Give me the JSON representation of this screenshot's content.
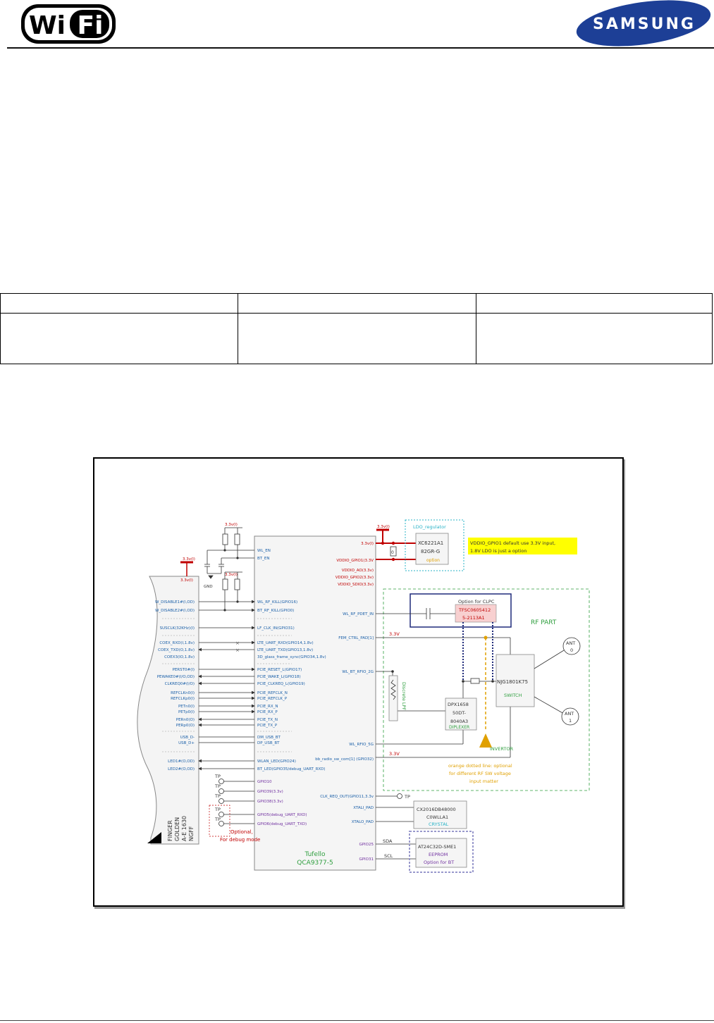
{
  "header": {
    "wifi_logo_text": "Wi Fi",
    "brand_logo_text": "SAMSUNG"
  },
  "table": {
    "rows": [
      [
        "",
        "",
        ""
      ],
      [
        "",
        "",
        ""
      ]
    ]
  },
  "colors": {
    "pin_blue": "#1a5fa8",
    "rail_red": "#c00000",
    "green": "#2e9e3e",
    "purple": "#7030a0",
    "teal": "#2ab3c7",
    "orange": "#e0a000",
    "navy": "#1f2a7a",
    "note_yellow": "#ffff00"
  },
  "schematic": {
    "left_pins": [
      "W_DISABLE1#(I,OD)",
      "W_DISABLE2#(I,OD)",
      "SUSCLK(32KHz)(I)",
      "COEX_RXD(I,1.8v)",
      "COEX_TXD(O,1.8v)",
      "COEX3(IO,1.8v)",
      "PERST0#(I)",
      "PEWAKE0#(I/O,OD)",
      "CLKREQ0#(I/O)",
      "REFCLKn0(I)",
      "REFCLKp0(I)",
      "PETn0(I)",
      "PETp0(I)",
      "PERn0(O)",
      "PERp0(O)",
      "USB_D-",
      "USB_D+",
      "LED1#(O,OD)",
      "LED2#(O,OD)"
    ],
    "chip_left_pins": [
      "WL_EN",
      "BT_EN",
      "WL_RF_KILL(GPIO16)",
      "BT_RF_KILL(GPIO0)",
      "LF_CLK_IN(GPIO31)",
      "LTE_UART_RXD(GPIO14,1.8v)",
      "LTE_UART_TXD(GPIO13,1.8v)",
      "3D_glass_frame_sync(GPIO34,1.8v)",
      "PCIE_RESET_L(GPIO17)",
      "PCIE_WAKE_L(GPIO18)",
      "PCIE_CLKREQ_L(GPIO19)",
      "PCIE_REFCLK_N",
      "PCIE_REFCLK_P",
      "PCIE_RX_N",
      "PCIE_RX_P",
      "PCIE_TX_N",
      "PCIE_TX_P",
      "DM_USB_BT",
      "DP_USB_BT",
      "WLAN_LED(GPIO24)",
      "BT_LED(GPIO35/debug_UART_RXD)",
      "GPIO10",
      "GPIO39(3.3v)",
      "GPIO38(3.3v)",
      "GPIO5(debug_UART_RXD)",
      "GPIO6(debug_UART_TXD)"
    ],
    "chip_right_pins": [
      "3.3v(I)",
      "VDDIO_GPIO1(3.3V",
      "VDDIO_AO(3.3v)",
      "VDDIO_GPIO2(3.3v)",
      "VDDIO_SDIO(3.3v)",
      "WL_RF_PDET_IN",
      "FEM_CTRL_PAD[1]",
      "WL_BT_RFIO_2G",
      "WL_RFIO_5G",
      "bb_radio_sw_com[1] (GPIO32)",
      "CLK_REQ_OUT(GPIO11,3.3v",
      "XTALI_PAD",
      "XTALO_PAD",
      "GPIO25",
      "GPIO31"
    ],
    "chip_name": "Tufello",
    "chip_part": "QCA9377-5",
    "rail_33_small": "3.3v(I)",
    "rail_33_big": "3.3V",
    "gnd": "GND",
    "tp": "TP",
    "zero": "0",
    "ldo_title": "LDO_regulator",
    "ldo_part1": "XC6221A1",
    "ldo_part2": "82GR-G",
    "ldo_option": "option",
    "note_line1": "VDDIO_GPIO1 default use 3.3V input,",
    "note_line2": "1.8V LDO is just a option",
    "clpc_title": "Option for CLPC",
    "clpc_part1": "TFSC0605412",
    "clpc_part2": "5-2113A1",
    "rf_part": "RF PART",
    "switch_part": "NJG1801K75",
    "switch_label": "SWITCH",
    "ant0_a": "ANT",
    "ant0_b": "0",
    "ant1_a": "ANT",
    "ant1_b": "1",
    "dpx1": "DPX1658",
    "dpx2": "50DT-",
    "dpx3": "8040A3",
    "dpx_label": "DIPLEXER",
    "lpf_label": "Discrete LPF",
    "invertor": "INVERTOR",
    "orange_note1": "orange dotted line: optional",
    "orange_note2": "for different RF SW voltage",
    "orange_note3": "input matter",
    "crystal1": "CX2016DB48000",
    "crystal2": "C0WLLA1",
    "crystal_label": "CRYSTAL",
    "sda": "SDA",
    "scl": "SCL",
    "eeprom1": "AT24C32D-SME1",
    "eeprom2": "EEPROM",
    "eeprom3": "Option for BT",
    "optional1": "Optional,",
    "optional2": "For debug mode",
    "finger1": "NGFF",
    "finger2": "A-E 1630",
    "finger3": "GOLDEN",
    "finger4": "FINGER"
  }
}
